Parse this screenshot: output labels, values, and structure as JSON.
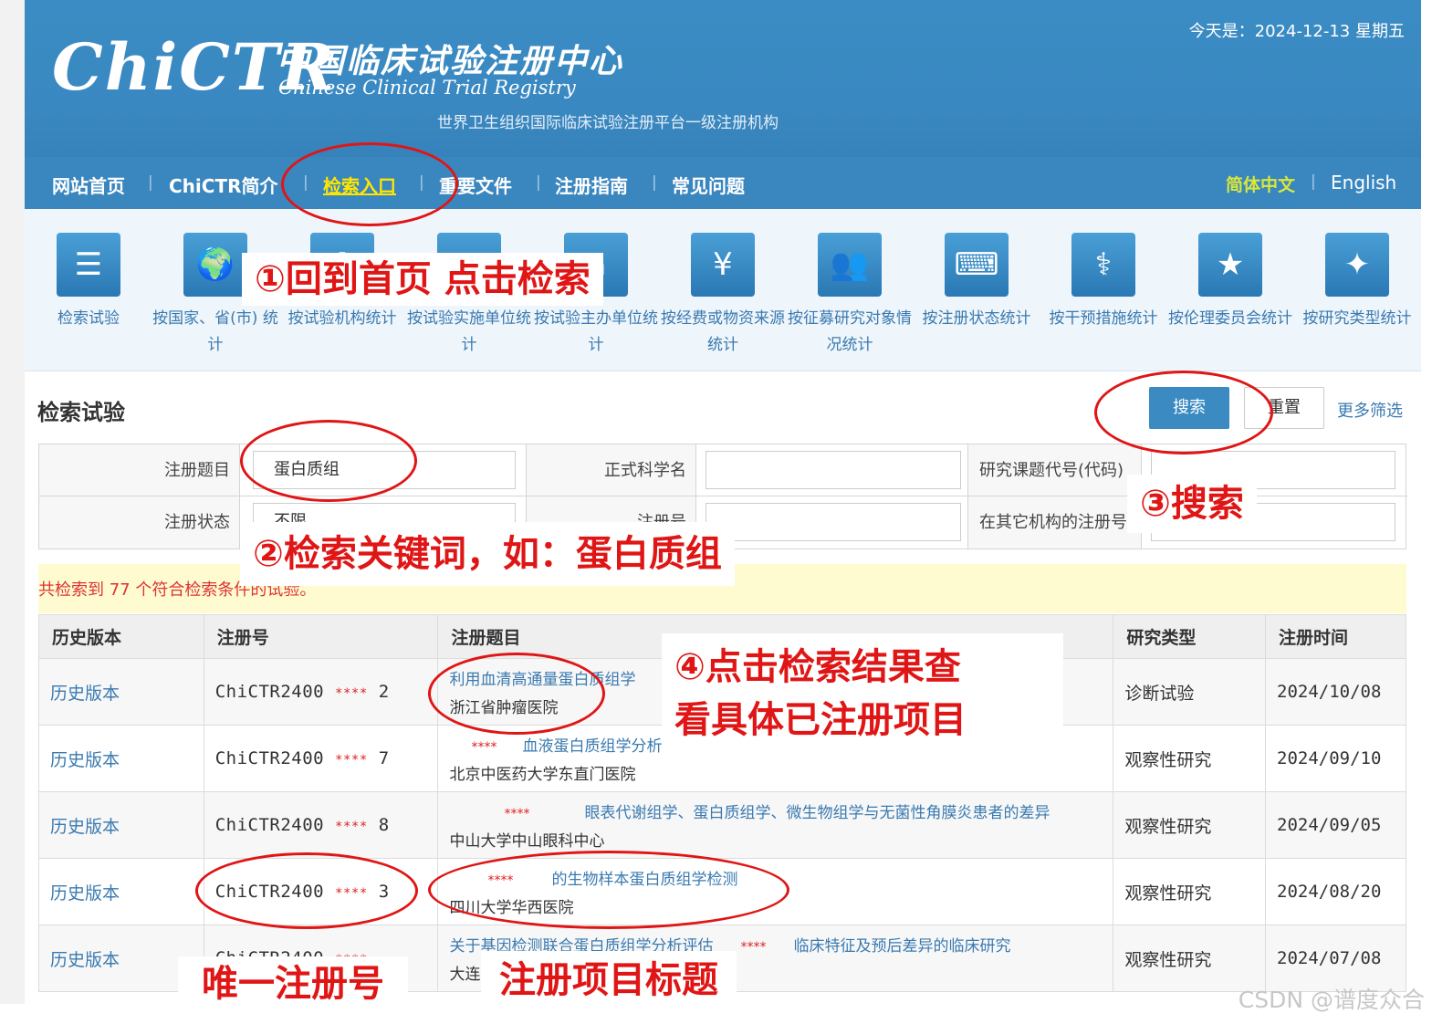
{
  "header": {
    "logo_text": "ChiCTR",
    "site_name_cn": "中国临床试验注册中心",
    "site_name_en": "Chinese Clinical Trial Registry",
    "subtitle": "世界卫生组织国际临床试验注册平台一级注册机构",
    "today": "今天是：2024-12-13 星期五"
  },
  "nav": {
    "items": [
      "网站首页",
      "ChiCTR简介",
      "检索入口",
      "重要文件",
      "注册指南",
      "常见问题"
    ],
    "active_index": 2,
    "lang_cn": "简体中文",
    "lang_en": "English"
  },
  "stats": {
    "items": [
      {
        "icon": "list-icon",
        "label": "检索试验"
      },
      {
        "icon": "world-map-icon",
        "label": "按国家、省(市) 统计"
      },
      {
        "icon": "institution-icon",
        "label": "按试验机构统计"
      },
      {
        "icon": "hospital-icon",
        "label": "按试验实施单位统计"
      },
      {
        "icon": "sponsor-icon",
        "label": "按试验主办单位统计"
      },
      {
        "icon": "funding-icon",
        "label": "按经费或物资来源统计"
      },
      {
        "icon": "people-icon",
        "label": "按征募研究对象情况统计"
      },
      {
        "icon": "keyboard-mouse-icon",
        "label": "按注册状态统计"
      },
      {
        "icon": "doctor-icon",
        "label": "按干预措施统计"
      },
      {
        "icon": "star-icon",
        "label": "按伦理委员会统计"
      },
      {
        "icon": "sparkle-icon",
        "label": "按研究类型统计"
      }
    ]
  },
  "search": {
    "title": "检索试验",
    "search_button": "搜索",
    "reset_button": "重置",
    "more_filters": "更多筛选",
    "fields": {
      "reg_title_label": "注册题目",
      "reg_title_value": "蛋白质组",
      "sci_name_label": "正式科学名",
      "sci_name_value": "",
      "project_code_label": "研究课题代号(代码)",
      "project_code_value": "",
      "status_label": "注册状态",
      "status_value": "不限",
      "reg_no_label": "注册号",
      "reg_no_value": "",
      "other_reg_label": "在其它机构的注册号",
      "other_reg_value": ""
    },
    "result_text": "共检索到 77 个符合检索条件的试验。"
  },
  "table": {
    "headers": [
      "历史版本",
      "注册号",
      "注册题目",
      "研究类型",
      "注册时间"
    ],
    "rows": [
      {
        "history": "历史版本",
        "reg_prefix": "ChiCTR2400",
        "reg_mask": "****",
        "reg_suffix": "2",
        "title": "利用血清高通量蛋白质组学",
        "title_mask": "",
        "institution": "浙江省肿瘤医院",
        "type": "诊断试验",
        "date": "2024/10/08"
      },
      {
        "history": "历史版本",
        "reg_prefix": "ChiCTR2400",
        "reg_mask": "****",
        "reg_suffix": "7",
        "title": "血液蛋白质组学分析",
        "title_mask": "****",
        "institution": "北京中医药大学东直门医院",
        "type": "观察性研究",
        "date": "2024/09/10"
      },
      {
        "history": "历史版本",
        "reg_prefix": "ChiCTR2400",
        "reg_mask": "****",
        "reg_suffix": "8",
        "title": "眼表代谢组学、蛋白质组学、微生物组学与无菌性角膜炎患者的差异",
        "title_mask": "****",
        "institution": "中山大学中山眼科中心",
        "type": "观察性研究",
        "date": "2024/09/05"
      },
      {
        "history": "历史版本",
        "reg_prefix": "ChiCTR2400",
        "reg_mask": "****",
        "reg_suffix": "3",
        "title": "的生物样本蛋白质组学检测",
        "title_mask": "****",
        "institution": "四川大学华西医院",
        "type": "观察性研究",
        "date": "2024/08/20"
      },
      {
        "history": "历史版本",
        "reg_prefix": "ChiCTR2400",
        "reg_mask": "****",
        "reg_suffix": "",
        "title": "关于基因检测联合蛋白质组学分析评估",
        "title_mask": "****",
        "title_tail": "临床特征及预后差异的临床研究",
        "institution": "大连",
        "type": "观察性研究",
        "date": "2024/07/08"
      }
    ]
  },
  "annotations": {
    "step1": "①回到首页 点击检索",
    "step2": "②检索关键词，如：蛋白质组",
    "step3": "③搜索",
    "step4_line1": "④点击检索结果查",
    "step4_line2": "看具体已注册项目",
    "label_regno": "唯一注册号",
    "label_title": "注册项目标题",
    "color": "#e01515"
  },
  "watermark": "CSDN @谱度众合"
}
